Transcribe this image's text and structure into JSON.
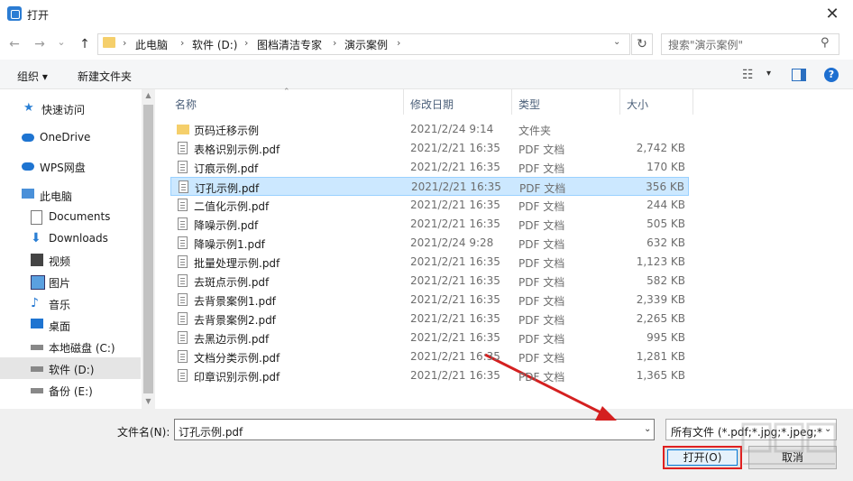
{
  "window": {
    "title": "打开",
    "close_glyph": "✕"
  },
  "nav": {
    "back": "←",
    "forward": "→",
    "recent": "⌄",
    "up": "↑",
    "breadcrumb": [
      "此电脑",
      "软件 (D:)",
      "图档清洁专家",
      "演示案例"
    ],
    "breadcrumb_sep": "›",
    "dropdown": "⌄",
    "refresh": "↻",
    "search_placeholder": "搜索\"演示案例\""
  },
  "toolbar": {
    "organize": "组织 ▾",
    "new_folder": "新建文件夹",
    "view_drop": "▾",
    "help": "?"
  },
  "sidebar": {
    "items": [
      {
        "label": "快速访问",
        "icon": "star-icon"
      },
      {
        "label": "OneDrive",
        "icon": "cloud-icon"
      },
      {
        "label": "WPS网盘",
        "icon": "cloud-icon"
      },
      {
        "label": "此电脑",
        "icon": "computer-icon"
      },
      {
        "label": "Documents",
        "icon": "document-icon"
      },
      {
        "label": "Downloads",
        "icon": "download-icon"
      },
      {
        "label": "视频",
        "icon": "video-icon"
      },
      {
        "label": "图片",
        "icon": "picture-icon"
      },
      {
        "label": "音乐",
        "icon": "music-icon"
      },
      {
        "label": "桌面",
        "icon": "desktop-icon"
      },
      {
        "label": "本地磁盘 (C:)",
        "icon": "drive-icon"
      },
      {
        "label": "软件 (D:)",
        "icon": "drive-icon",
        "selected": true
      },
      {
        "label": "备份 (E:)",
        "icon": "drive-icon"
      }
    ]
  },
  "columns": {
    "name": "名称",
    "date": "修改日期",
    "type": "类型",
    "size": "大小"
  },
  "files": [
    {
      "name": "页码迁移示例",
      "date": "2021/2/24 9:14",
      "type": "文件夹",
      "size": "",
      "folder": true
    },
    {
      "name": "表格识别示例.pdf",
      "date": "2021/2/21 16:35",
      "type": "PDF 文档",
      "size": "2,742 KB"
    },
    {
      "name": "订痕示例.pdf",
      "date": "2021/2/21 16:35",
      "type": "PDF 文档",
      "size": "170 KB"
    },
    {
      "name": "订孔示例.pdf",
      "date": "2021/2/21 16:35",
      "type": "PDF 文档",
      "size": "356 KB",
      "selected": true
    },
    {
      "name": "二值化示例.pdf",
      "date": "2021/2/21 16:35",
      "type": "PDF 文档",
      "size": "244 KB"
    },
    {
      "name": "降噪示例.pdf",
      "date": "2021/2/21 16:35",
      "type": "PDF 文档",
      "size": "505 KB"
    },
    {
      "name": "降噪示例1.pdf",
      "date": "2021/2/24 9:28",
      "type": "PDF 文档",
      "size": "632 KB"
    },
    {
      "name": "批量处理示例.pdf",
      "date": "2021/2/21 16:35",
      "type": "PDF 文档",
      "size": "1,123 KB"
    },
    {
      "name": "去斑点示例.pdf",
      "date": "2021/2/21 16:35",
      "type": "PDF 文档",
      "size": "582 KB"
    },
    {
      "name": "去背景案例1.pdf",
      "date": "2021/2/21 16:35",
      "type": "PDF 文档",
      "size": "2,339 KB"
    },
    {
      "name": "去背景案例2.pdf",
      "date": "2021/2/21 16:35",
      "type": "PDF 文档",
      "size": "2,265 KB"
    },
    {
      "name": "去黑边示例.pdf",
      "date": "2021/2/21 16:35",
      "type": "PDF 文档",
      "size": "995 KB"
    },
    {
      "name": "文档分类示例.pdf",
      "date": "2021/2/21 16:35",
      "type": "PDF 文档",
      "size": "1,281 KB"
    },
    {
      "name": "印章识别示例.pdf",
      "date": "2021/2/21 16:35",
      "type": "PDF 文档",
      "size": "1,365 KB"
    }
  ],
  "footer": {
    "filename_label": "文件名(N):",
    "filename_value": "订孔示例.pdf",
    "filter": "所有文件 (*.pdf;*.jpg;*.jpeg;*.j",
    "open": "打开(O)",
    "cancel": "取消"
  },
  "colors": {
    "accent": "#0078d7",
    "selection": "#cce8ff",
    "highlight": "#e02020",
    "folder": "#f5cf6b"
  }
}
